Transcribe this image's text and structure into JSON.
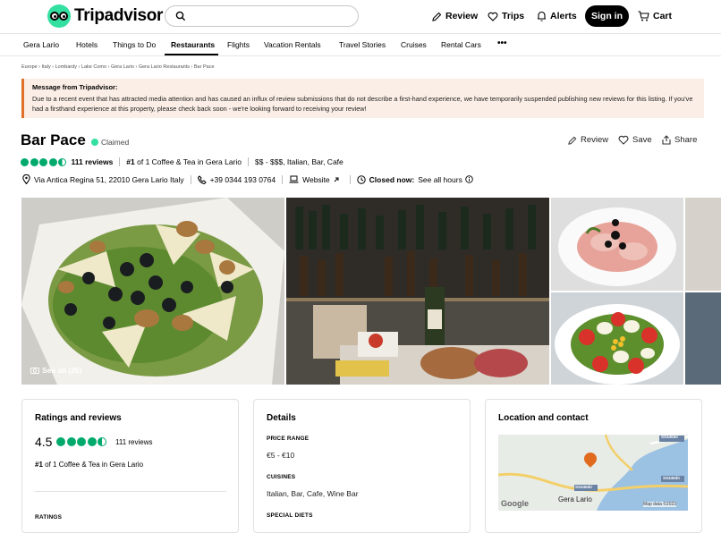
{
  "header": {
    "logo_text": "Tripadvisor",
    "search_placeholder": "",
    "review_label": "Review",
    "trips_label": "Trips",
    "alerts_label": "Alerts",
    "signin_label": "Sign in",
    "cart_label": "Cart",
    "brand_color": "#34e0a1"
  },
  "subnav": {
    "items": [
      "Gera Lario",
      "Hotels",
      "Things to Do",
      "Restaurants",
      "Flights",
      "Vacation Rentals",
      "Travel Stories",
      "Cruises",
      "Rental Cars"
    ],
    "active": "Restaurants",
    "more_label": "•••"
  },
  "breadcrumb": "Europe › Italy › Lombardy › Lake Como › Gera Lario › Gera Lario Restaurants › Bar Pace",
  "notice": {
    "title": "Message from Tripadvisor:",
    "body": "Due to a recent event that has attracted media attention and has caused an influx of review submissions that do not describe a first-hand experience, we have temporarily suspended publishing new reviews for this listing. If you've had a firsthand experience at this property, please check back soon - we're looking forward to receiving your review!"
  },
  "listing": {
    "name": "Bar Pace",
    "claimed_label": "Claimed",
    "review_action": "Review",
    "save_action": "Save",
    "share_action": "Share",
    "rating": 4.5,
    "reviews_count": "111 reviews",
    "ranking_prefix": "#1",
    "ranking_text": " of 1 Coffee & Tea in Gera Lario",
    "price_cuisines": "$$ - $$$, Italian, Bar, Cafe",
    "address": "Via Antica Regina 51, 22010 Gera Lario Italy",
    "phone": "+39 0344 193 0764",
    "website_label": "Website",
    "closed_label": "Closed now:",
    "hours_label": "See all hours",
    "rating_color": "#00aa6c"
  },
  "photos": {
    "see_all_label": "See all (26)"
  },
  "ratings_card": {
    "heading": "Ratings and reviews",
    "rating": "4.5",
    "reviews": "111 reviews",
    "rank_prefix": "#1",
    "rank_text": " of 1 Coffee & Tea in Gera Lario",
    "ratings_label": "RATINGS"
  },
  "details_card": {
    "heading": "Details",
    "price_range_label": "PRICE RANGE",
    "price_range": "€5 - €10",
    "cuisines_label": "CUISINES",
    "cuisines": "Italian, Bar, Cafe, Wine Bar",
    "special_diets_label": "SPECIAL DIETS"
  },
  "location_card": {
    "heading": "Location and contact",
    "map_label_town": "Gera Lario",
    "map_attrib": "Map data ©2023",
    "map_google": "Google",
    "road_1": "SS340dir",
    "road_2": "SS340dir",
    "road_3": "SS340dir"
  }
}
